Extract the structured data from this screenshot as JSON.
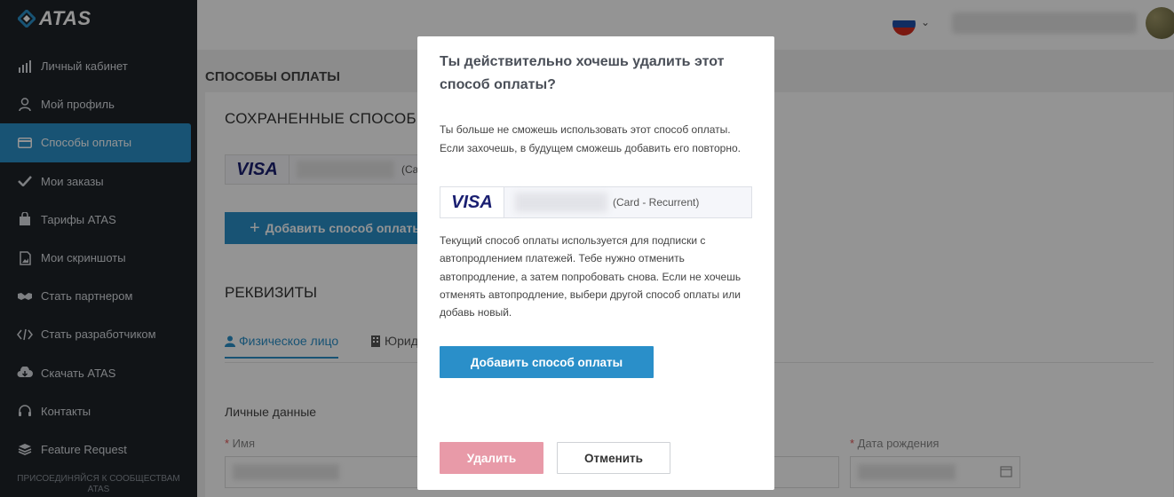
{
  "app": {
    "logo_text": "ATAS"
  },
  "sidebar": {
    "items": [
      {
        "label": "Личный кабинет",
        "icon": "chart-bars-icon"
      },
      {
        "label": "Мой профиль",
        "icon": "user-icon"
      },
      {
        "label": "Способы оплаты",
        "icon": "credit-card-icon",
        "active": true
      },
      {
        "label": "Мои заказы",
        "icon": "checkmark-icon"
      },
      {
        "label": "Тарифы ATAS",
        "icon": "shopping-bag-icon"
      },
      {
        "label": "Мои скриншоты",
        "icon": "image-file-icon"
      },
      {
        "label": "Стать партнером",
        "icon": "handshake-icon"
      },
      {
        "label": "Стать разработчиком",
        "icon": "code-icon"
      },
      {
        "label": "Скачать ATAS",
        "icon": "cloud-download-icon"
      },
      {
        "label": "Контакты",
        "icon": "headset-icon"
      },
      {
        "label": "Feature Request",
        "icon": "layers-icon"
      }
    ],
    "footer": "ПРИСОЕДИНЯЙСЯ К СООБЩЕСТВАМ ATAS"
  },
  "header": {
    "language_flag": "ru-flag-icon"
  },
  "main": {
    "page_title": "СПОСОБЫ ОПЛАТЫ",
    "saved_title": "СОХРАНЕННЫЕ СПОСОБЫ",
    "saved_card": {
      "brand": "VISA",
      "type": "(Card"
    },
    "add_button": "Добавить способ оплаты",
    "requisites_title": "РЕКВИЗИТЫ",
    "tabs": [
      "Физическое лицо",
      "Юридическое лицо"
    ],
    "personal_data": "Личные данные",
    "field_name": "Имя",
    "field_dob": "Дата рождения"
  },
  "modal": {
    "title": "Ты действительно хочешь удалить этот способ оплаты?",
    "text1": "Ты больше не сможешь использовать этот способ оплаты. Если захочешь, в будущем сможешь добавить его повторно.",
    "card_brand": "VISA",
    "card_type": "(Card - Recurrent)",
    "text2": "Текущий способ оплаты используется для подписки с автопродлением платежей. Тебе нужно отменить автопродление, а затем попробовать снова. Если не хочешь отменять автопродление, выбери другой способ оплаты или добавь новый.",
    "add_button": "Добавить способ оплаты",
    "delete_button": "Удалить",
    "cancel_button": "Отменить"
  },
  "colors": {
    "accent": "#2a8fc9",
    "sidebar_bg": "#1e2328",
    "delete_disabled": "#e89aa8",
    "visa_blue": "#1a1f71"
  }
}
